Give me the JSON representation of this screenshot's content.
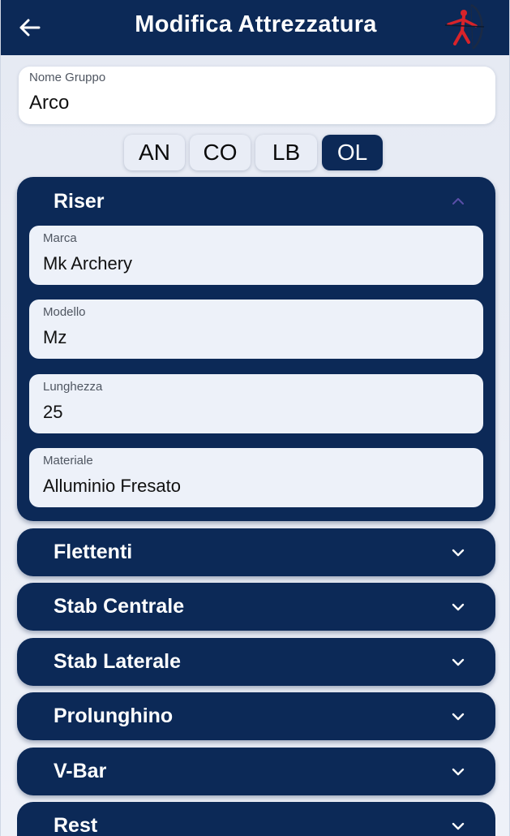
{
  "appbar": {
    "title": "Modifica Attrezzatura",
    "back_icon": "arrow-left-icon",
    "logo_icon": "archer-logo-icon",
    "background": "#0c2957"
  },
  "group_name": {
    "label": "Nome Gruppo",
    "value": "Arco"
  },
  "bow_types": [
    {
      "label": "AN",
      "selected": false
    },
    {
      "label": "CO",
      "selected": false
    },
    {
      "label": "LB",
      "selected": false
    },
    {
      "label": "OL",
      "selected": true
    }
  ],
  "sections": [
    {
      "title": "Riser",
      "expanded": true,
      "chevron_icon": "chevron-up-icon",
      "fields": [
        {
          "label": "Marca",
          "value": "Mk Archery"
        },
        {
          "label": "Modello",
          "value": "Mz"
        },
        {
          "label": "Lunghezza",
          "value": "25"
        },
        {
          "label": "Materiale",
          "value": "Alluminio Fresato"
        }
      ]
    },
    {
      "title": "Flettenti",
      "expanded": false,
      "chevron_icon": "chevron-down-icon"
    },
    {
      "title": "Stab Centrale",
      "expanded": false,
      "chevron_icon": "chevron-down-icon"
    },
    {
      "title": "Stab Laterale",
      "expanded": false,
      "chevron_icon": "chevron-down-icon"
    },
    {
      "title": "Prolunghino",
      "expanded": false,
      "chevron_icon": "chevron-down-icon"
    },
    {
      "title": "V-Bar",
      "expanded": false,
      "chevron_icon": "chevron-down-icon"
    },
    {
      "title": "Rest",
      "expanded": false,
      "chevron_icon": "chevron-down-icon"
    }
  ],
  "colors": {
    "primary": "#0c2957",
    "accent_red": "#d8232a",
    "chevron_up": "#5a4fa8",
    "field_background": "#edf1f9"
  }
}
